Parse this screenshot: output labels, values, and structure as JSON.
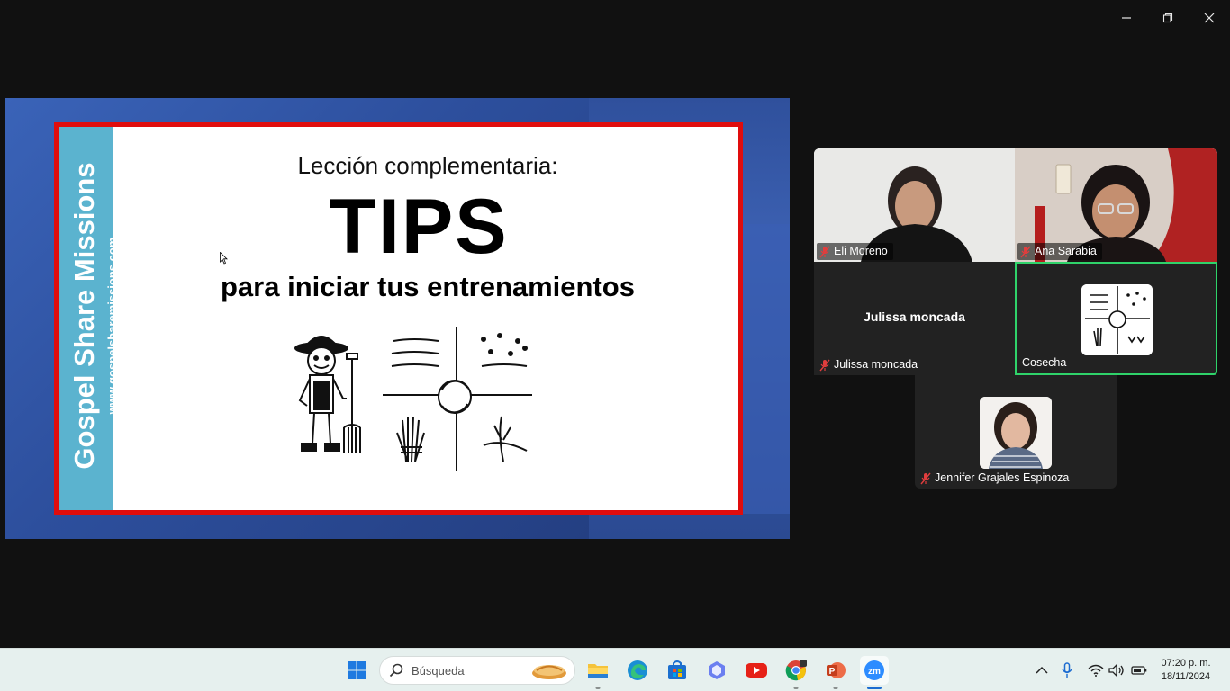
{
  "window": {
    "controls": [
      "minimize",
      "restore",
      "close"
    ]
  },
  "slide": {
    "brand": "Gospel Share Missions",
    "url": "www.gospelsharemissions.com",
    "subtitle": "Lección complementaria:",
    "title": "TIPS",
    "tagline": "para iniciar tus entrenamientos",
    "frame_color": "#e00d0d",
    "side_color": "#5bb3cf"
  },
  "participants": [
    {
      "name": "Eli Moreno",
      "muted": true,
      "video": true
    },
    {
      "name": "Ana Sarabia",
      "muted": true,
      "video": true
    },
    {
      "name": "Julissa moncada",
      "display_name": "Julissa moncada",
      "muted": true,
      "video": false
    },
    {
      "name": "Cosecha",
      "muted": false,
      "video": false,
      "active_speaker": true
    },
    {
      "name": "Jennifer Grajales Espinoza",
      "muted": true,
      "video": false
    }
  ],
  "active_speaker_color": "#2fd36a",
  "taskbar": {
    "search_placeholder": "Búsqueda",
    "apps": [
      "start",
      "search",
      "file-explorer",
      "edge",
      "store",
      "copilot",
      "youtube",
      "chrome",
      "powerpoint",
      "zoom"
    ],
    "active_app": "zoom",
    "clock_time": "07:20 p. m.",
    "clock_date": "18/11/2024"
  }
}
